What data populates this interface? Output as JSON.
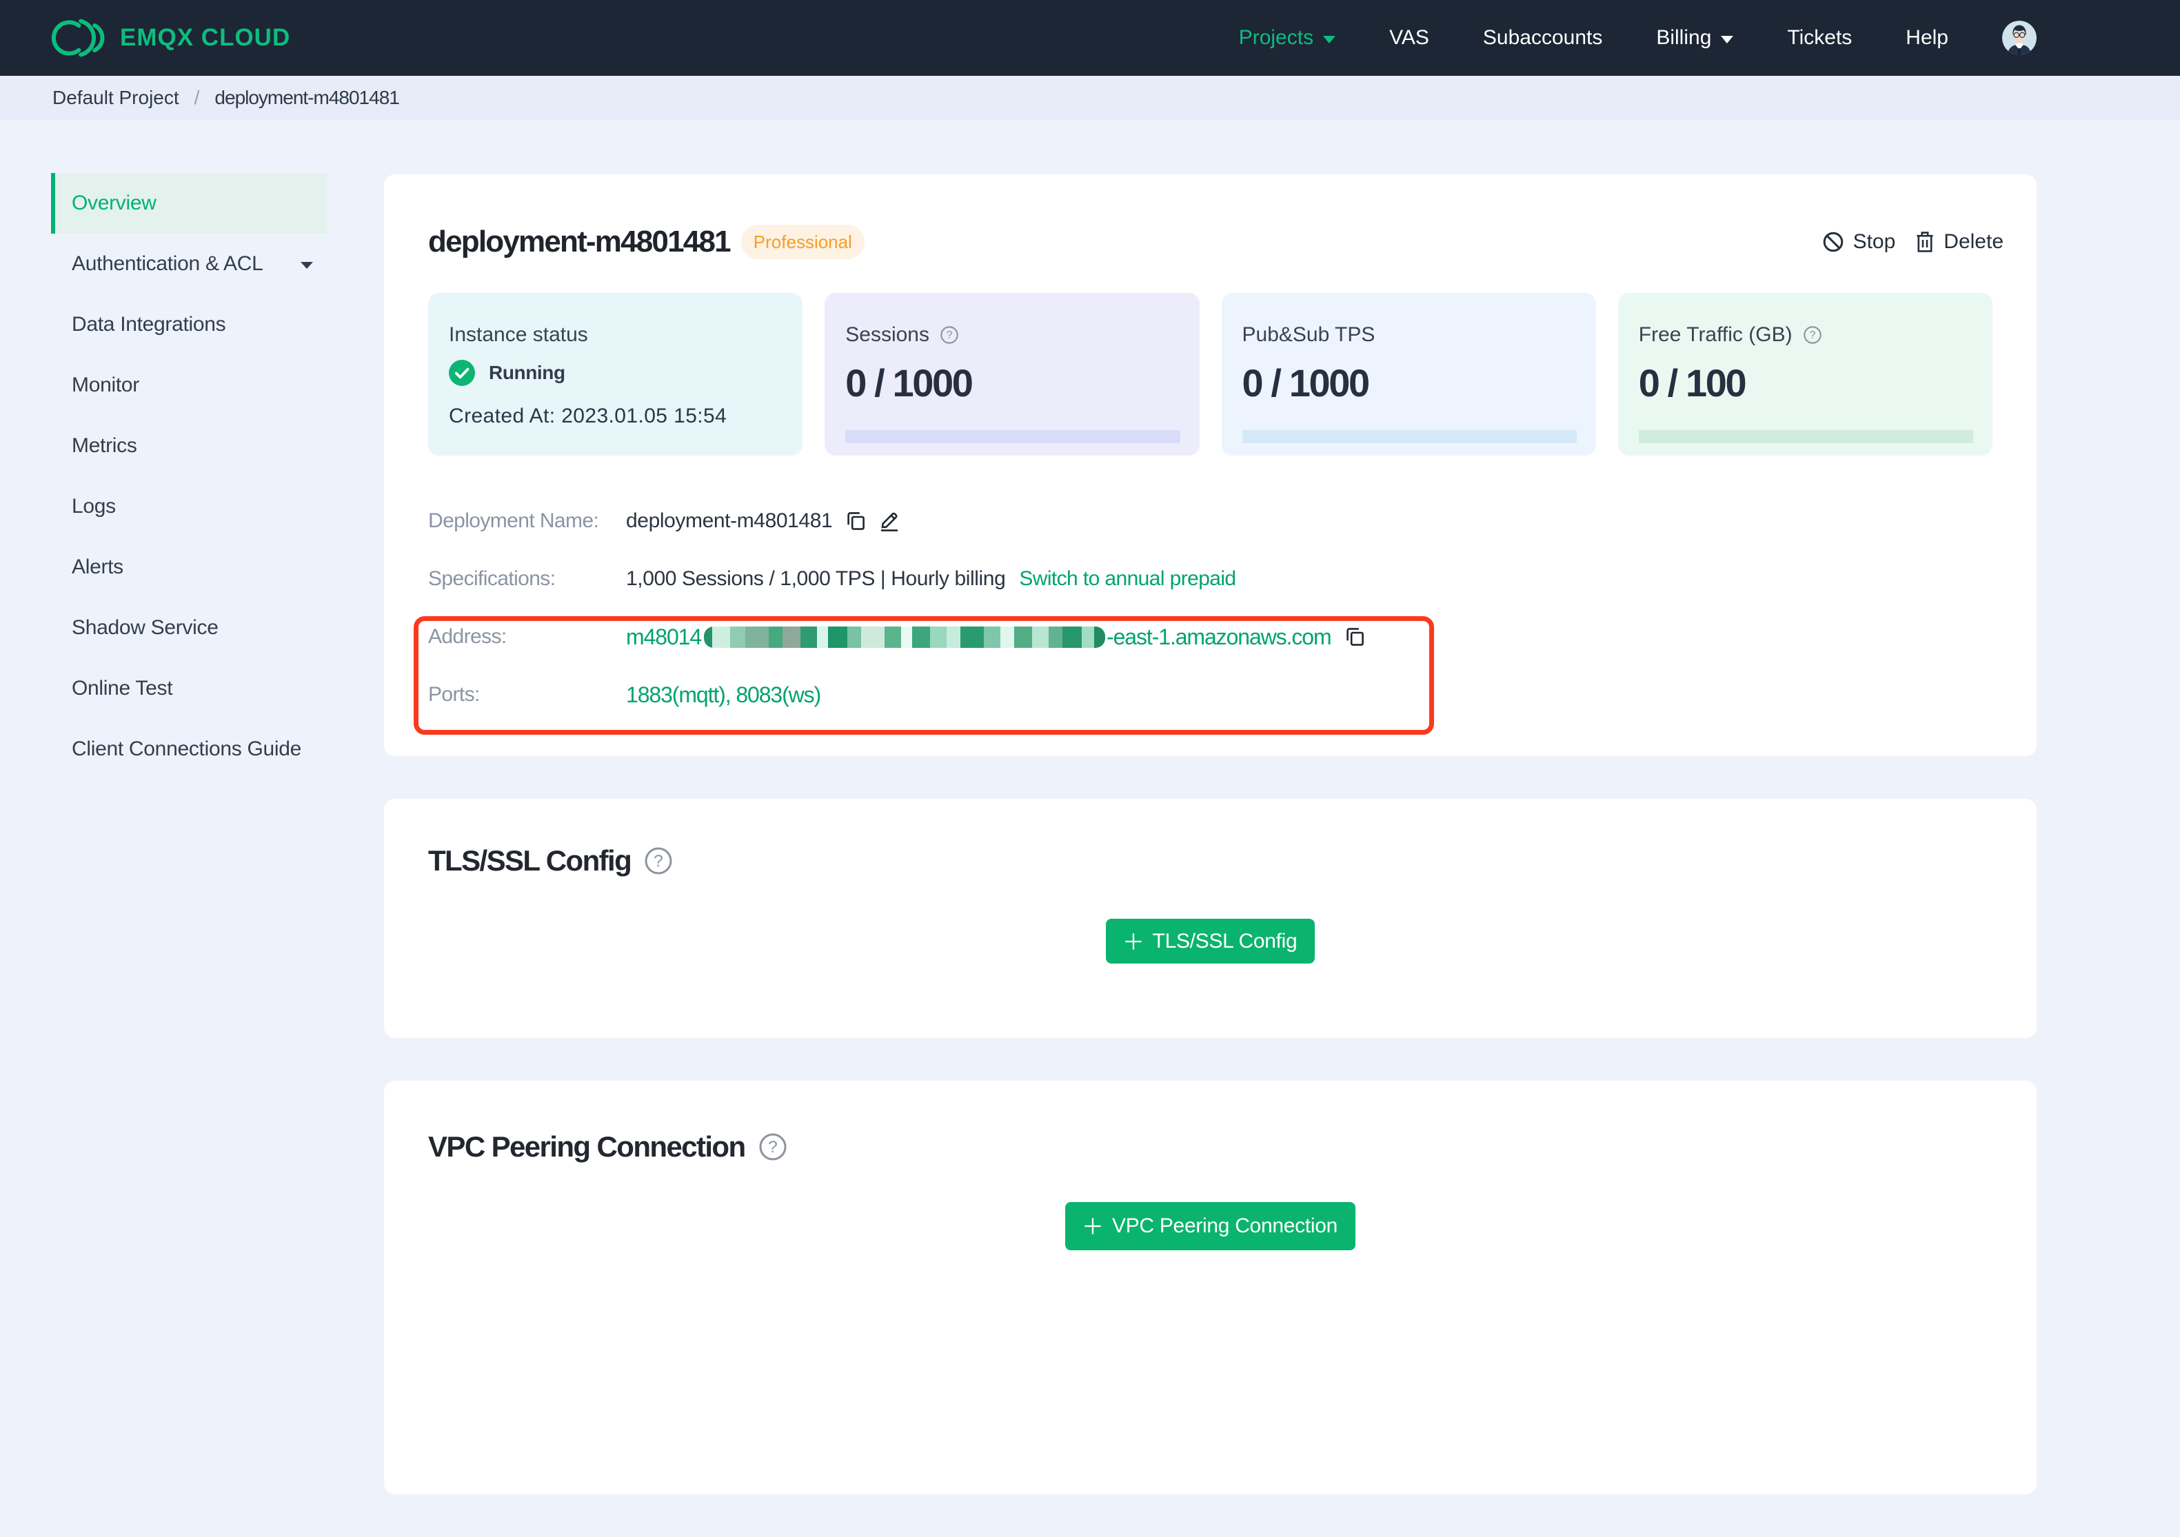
{
  "navbar": {
    "brand": "EMQX CLOUD",
    "items": [
      {
        "label": "Projects"
      },
      {
        "label": "VAS"
      },
      {
        "label": "Subaccounts"
      },
      {
        "label": "Billing"
      },
      {
        "label": "Tickets"
      },
      {
        "label": "Help"
      }
    ]
  },
  "breadcrumb": {
    "project": "Default Project",
    "separator": "/",
    "page": "deployment-m4801481"
  },
  "sidebar": {
    "items": [
      {
        "label": "Overview"
      },
      {
        "label": "Authentication & ACL"
      },
      {
        "label": "Data Integrations"
      },
      {
        "label": "Monitor"
      },
      {
        "label": "Metrics"
      },
      {
        "label": "Logs"
      },
      {
        "label": "Alerts"
      },
      {
        "label": "Shadow Service"
      },
      {
        "label": "Online Test"
      },
      {
        "label": "Client Connections Guide"
      }
    ]
  },
  "deployment": {
    "title": "deployment-m4801481",
    "badge": "Professional",
    "stop_label": "Stop",
    "delete_label": "Delete",
    "stats": {
      "instance": {
        "label": "Instance status",
        "status": "Running",
        "created": "Created At: 2023.01.05 15:54"
      },
      "sessions": {
        "label": "Sessions",
        "value": "0 / 1000",
        "progress_percent": 0
      },
      "tps": {
        "label": "Pub&Sub TPS",
        "value": "0 / 1000",
        "progress_percent": 0
      },
      "traffic": {
        "label": "Free Traffic (GB)",
        "value": "0 / 100",
        "progress_percent": 0
      }
    },
    "details": {
      "name_label": "Deployment Name:",
      "name_value": "deployment-m4801481",
      "spec_label": "Specifications:",
      "spec_value": "1,000 Sessions / 1,000 TPS | Hourly billing",
      "spec_link": "Switch to annual prepaid",
      "address_label": "Address:",
      "address_prefix": "m48014",
      "address_suffix": "-east-1.amazonaws.com",
      "ports_label": "Ports:",
      "ports_value": "1883(mqtt), 8083(ws)"
    }
  },
  "sections": {
    "tls": {
      "title": "TLS/SSL Config",
      "button": "TLS/SSL Config"
    },
    "vpc": {
      "title": "VPC Peering Connection",
      "button": "VPC Peering Connection"
    }
  },
  "colors": {
    "brand_green": "#0cbd7e",
    "link_green": "#00a36d",
    "button_green": "#0bb46e",
    "navbar_bg": "#1d2634",
    "annotation_red": "#f93a1e",
    "badge_orange": "#f79e27",
    "status_green": "#0db574",
    "sidebar_active_green": "#00b173"
  },
  "mosaic_blocks": [
    {
      "w": 6,
      "c": "#28926a"
    },
    {
      "w": 13,
      "c": "#cfeee2"
    },
    {
      "w": 11,
      "c": "#8fccb2"
    },
    {
      "w": 17,
      "c": "#7fb39d"
    },
    {
      "w": 10,
      "c": "#46aa80"
    },
    {
      "w": 13,
      "c": "#8fa89b"
    },
    {
      "w": 12,
      "c": "#2f9b72"
    },
    {
      "w": 8,
      "c": "#d9f4ea"
    },
    {
      "w": 14,
      "c": "#1f9569"
    },
    {
      "w": 10,
      "c": "#79c2a5"
    },
    {
      "w": 17,
      "c": "#cfeadd"
    },
    {
      "w": 12,
      "c": "#5bb58c"
    },
    {
      "w": 8,
      "c": "#eaf9f3"
    },
    {
      "w": 13,
      "c": "#3da67c"
    },
    {
      "w": 12,
      "c": "#99d8bf"
    },
    {
      "w": 10,
      "c": "#c5ecdc"
    },
    {
      "w": 17,
      "c": "#2a9b71"
    },
    {
      "w": 12,
      "c": "#7fc7ab"
    },
    {
      "w": 10,
      "c": "#e0f6ee"
    },
    {
      "w": 13,
      "c": "#52ad85"
    },
    {
      "w": 12,
      "c": "#b7e6d3"
    },
    {
      "w": 10,
      "c": "#62b38f"
    },
    {
      "w": 14,
      "c": "#27976e"
    },
    {
      "w": 9,
      "c": "#a3dcc5"
    },
    {
      "w": 8,
      "c": "#218c64"
    }
  ]
}
